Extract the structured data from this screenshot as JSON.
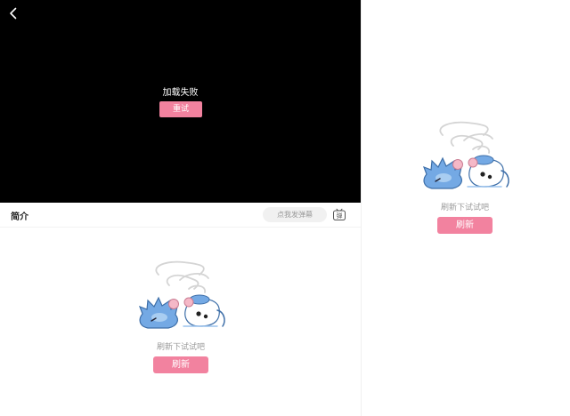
{
  "player": {
    "error_text": "加载失败",
    "retry_label": "重试"
  },
  "tabs": {
    "intro_label": "简介",
    "danmaku_placeholder": "点我发弹幕",
    "danmaku_toggle_glyph": "弹"
  },
  "intro_panel": {
    "empty_message": "刷新下试试吧",
    "refresh_label": "刷新"
  },
  "side_panel": {
    "empty_message": "刷新下试试吧",
    "refresh_label": "刷新"
  },
  "colors": {
    "accent": "#f2829f",
    "player_bg": "#000000",
    "mascot_blue": "#74a9e4",
    "muted_text": "#9a9a9a"
  },
  "icons": {
    "back": "back-arrow-icon",
    "danmaku": "danmaku-toggle-icon",
    "illustration": "sleeping-mascot-illustration"
  }
}
